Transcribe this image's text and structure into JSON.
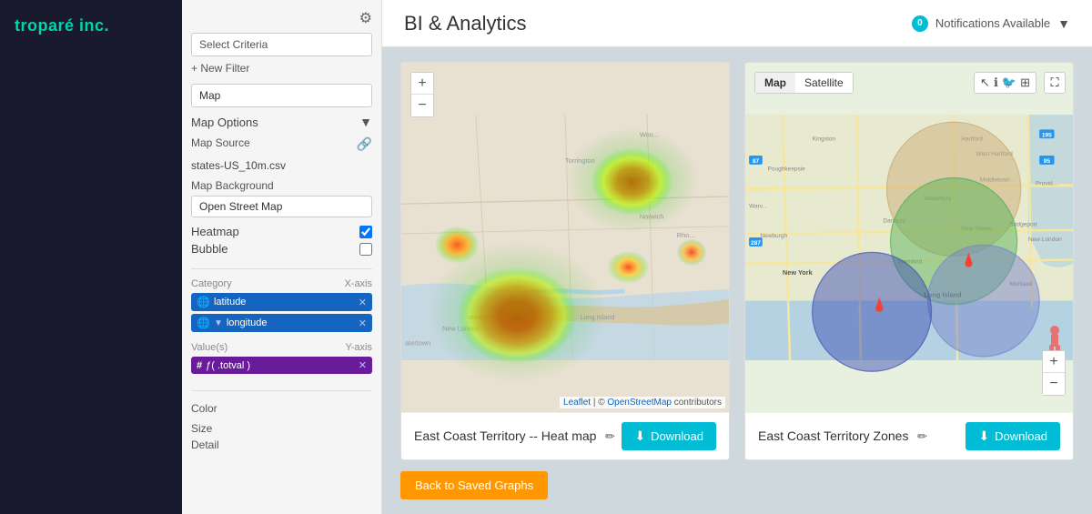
{
  "brand": {
    "name": "troparé inc."
  },
  "header": {
    "title": "BI & Analytics",
    "notifications_count": "0",
    "notifications_label": "Notifications Available"
  },
  "sidebar": {
    "gear_label": "⚙",
    "select_criteria_placeholder": "Select Criteria",
    "new_filter_label": "+ New Filter",
    "map_option": "Map",
    "map_options_label": "Map Options",
    "map_source_label": "Map Source",
    "map_source_file": "states-US_10m.csv",
    "map_background_label": "Map Background",
    "map_background_option": "Open Street Map",
    "heatmap_label": "Heatmap",
    "heatmap_checked": true,
    "bubble_label": "Bubble",
    "bubble_checked": false,
    "category_label": "Category",
    "x_axis_label": "X-axis",
    "latitude_chip": "latitude",
    "longitude_chip": "longitude",
    "values_label": "Value(s)",
    "y_axis_label": "Y-axis",
    "values_func": "ƒ( .totval )",
    "color_label": "Color",
    "size_label": "Size",
    "detail_label": "Detail"
  },
  "charts": [
    {
      "id": "heatmap",
      "title": "East Coast Territory -- Heat map",
      "download_label": "Download",
      "type": "heatmap"
    },
    {
      "id": "zones",
      "title": "East Coast Territory Zones",
      "download_label": "Download",
      "type": "zones"
    }
  ],
  "back_button_label": "Back to Saved Graphs",
  "map_tabs": [
    "Map",
    "Satellite"
  ],
  "active_tab": "Map"
}
